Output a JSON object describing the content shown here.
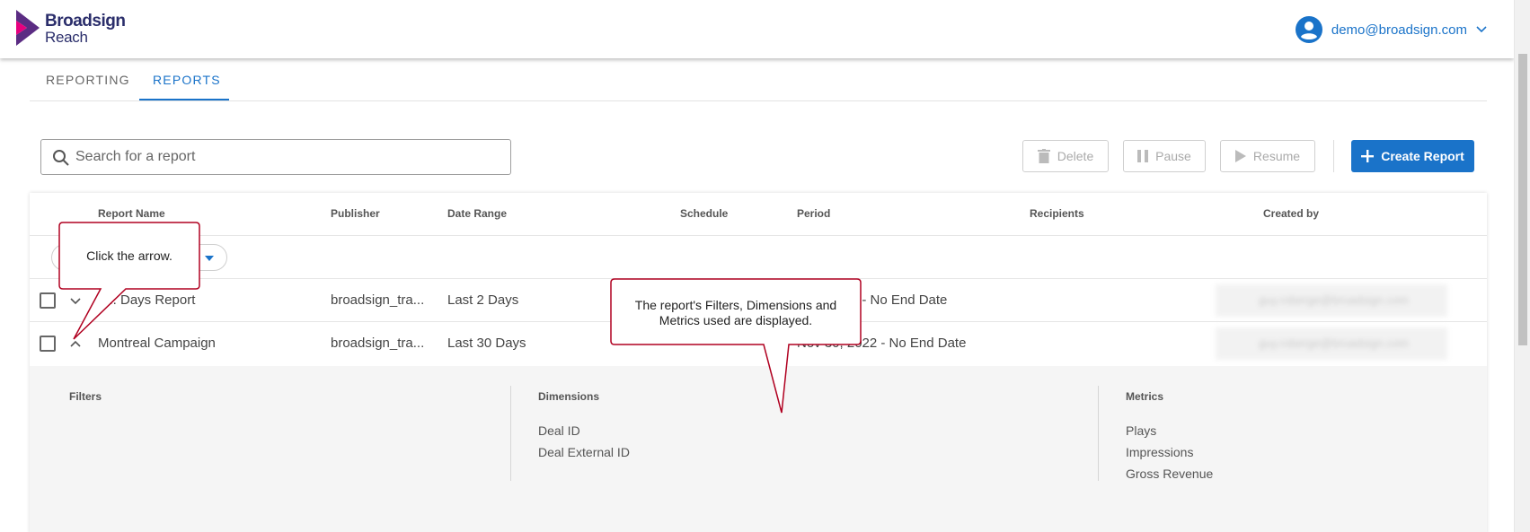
{
  "header": {
    "logo_line1": "Broadsign",
    "logo_line2": "Reach",
    "user_email": "demo@broadsign.com"
  },
  "tabs": [
    {
      "label": "REPORTING",
      "active": false
    },
    {
      "label": "REPORTS",
      "active": true
    }
  ],
  "toolbar": {
    "search_placeholder": "Search for a report",
    "delete_label": "Delete",
    "pause_label": "Pause",
    "resume_label": "Resume",
    "create_label": "Create Report"
  },
  "table": {
    "columns": [
      "Report Name",
      "Publisher",
      "Date Range",
      "Schedule",
      "Period",
      "Recipients",
      "Created by"
    ],
    "rows": [
      {
        "name": "L... Days Report",
        "publisher": "broadsign_tra...",
        "date_range": "Last 2 Days",
        "period": "...22 - No End Date",
        "created_by": "guy.roberge@broadsign.com"
      },
      {
        "name": "Montreal Campaign",
        "publisher": "broadsign_tra...",
        "date_range": "Last 30 Days",
        "period": "Nov 30, 2022 - No End Date",
        "created_by": "guy.roberge@broadsign.com"
      }
    ],
    "detail": {
      "filters_title": "Filters",
      "dimensions_title": "Dimensions",
      "dimensions": [
        "Deal ID",
        "Deal External ID"
      ],
      "metrics_title": "Metrics",
      "metrics": [
        "Plays",
        "Impressions",
        "Gross Revenue"
      ]
    }
  },
  "callouts": {
    "arrow_hint": "Click the arrow.",
    "detail_hint_line1": "The report's Filters, Dimensions and",
    "detail_hint_line2": "Metrics used are displayed."
  },
  "colors": {
    "accent": "#1a73c9",
    "brand": "#2b2e6b",
    "callout_border": "#b00020"
  }
}
